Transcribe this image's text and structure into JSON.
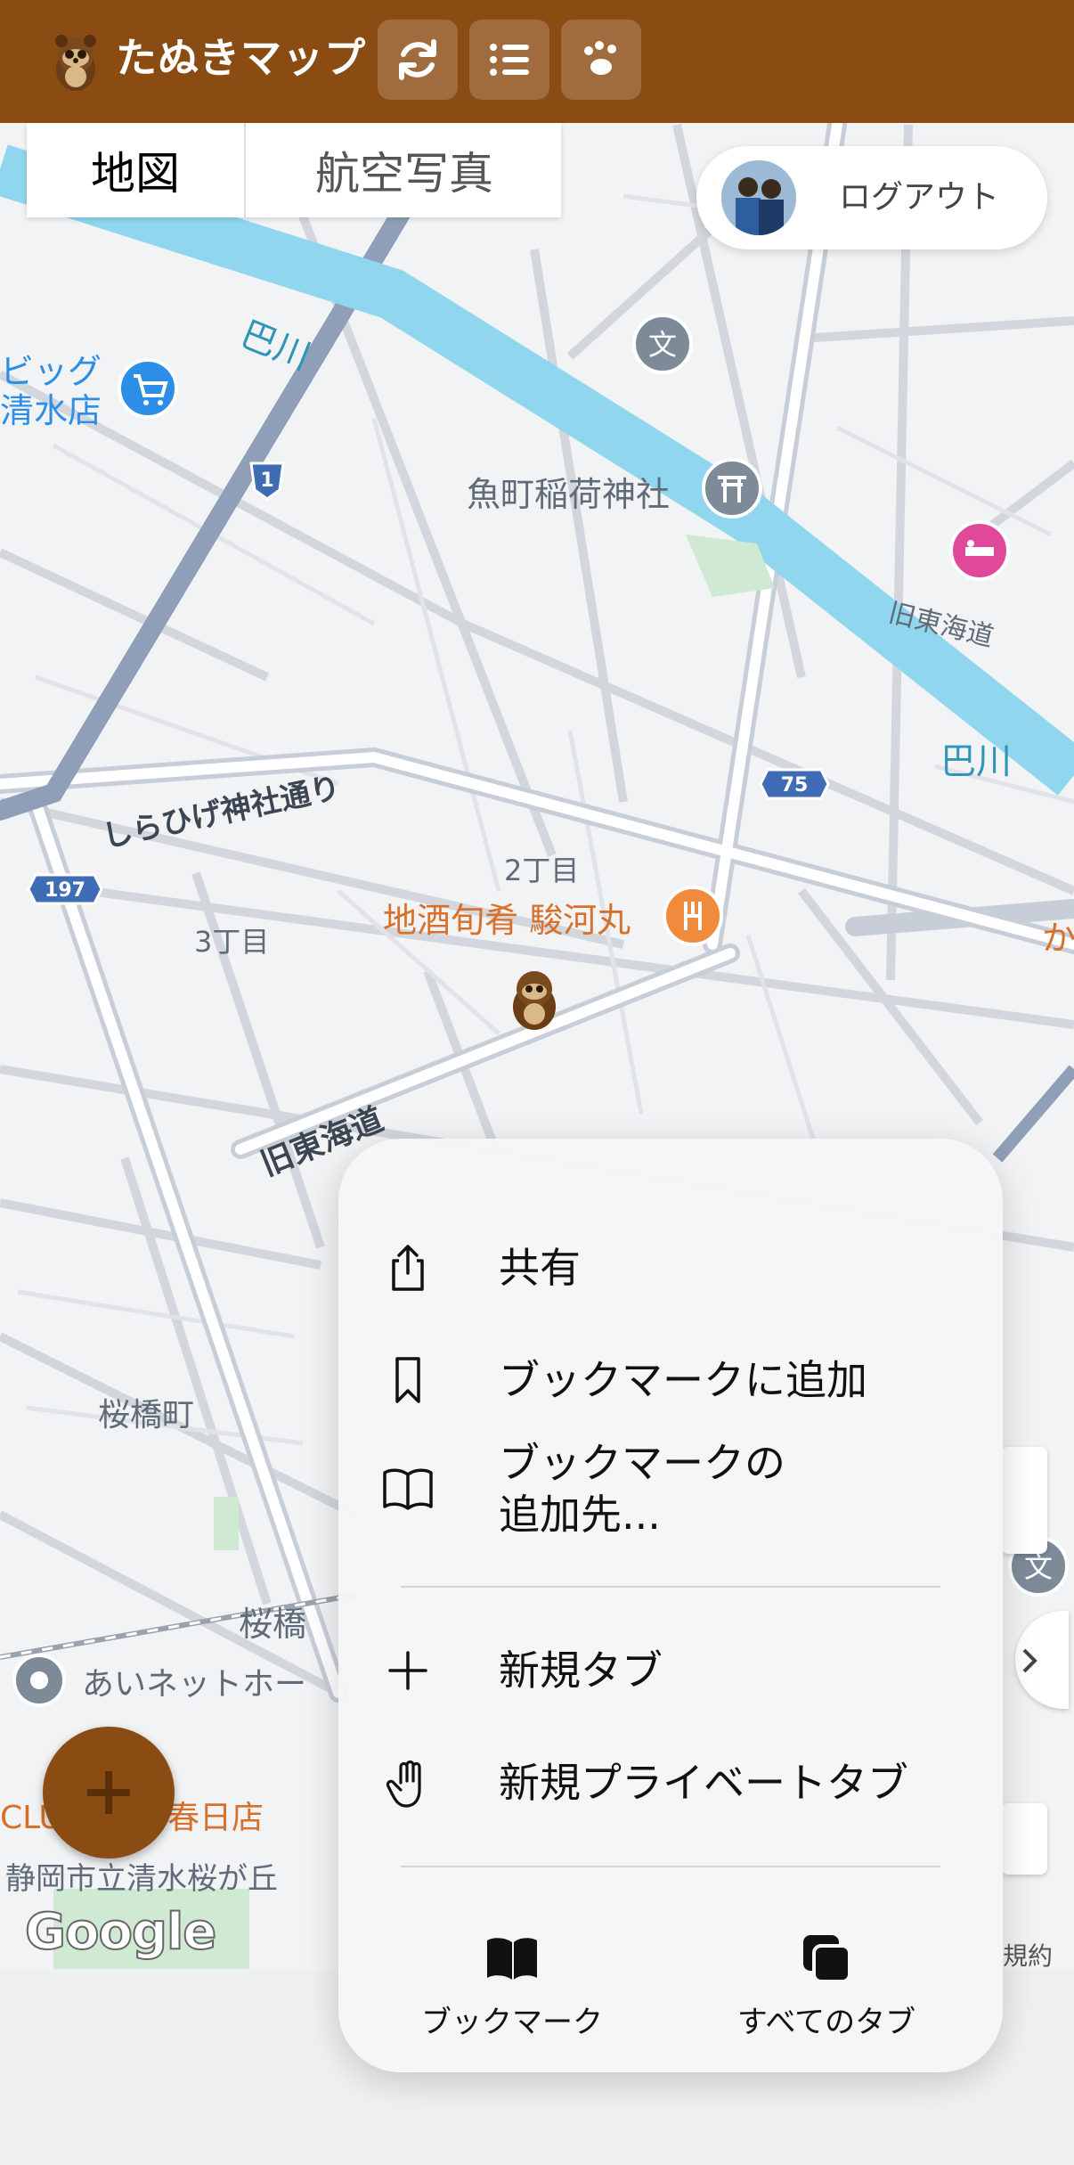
{
  "header": {
    "title": "たぬきマップ",
    "buttons": [
      "refresh-icon",
      "list-icon",
      "paw-icon"
    ]
  },
  "map_tabs": {
    "map": "地図",
    "satellite": "航空写真"
  },
  "user": {
    "logout_label": "ログアウト"
  },
  "map_labels": {
    "river1": "巴川",
    "river2": "巴川",
    "store_line1": "ビッグ",
    "store_line2": "清水店",
    "shrine": "魚町稲荷神社",
    "old_tokaido1": "旧東海道",
    "old_tokaido2": "旧東海道",
    "street": "しらひげ神社通り",
    "chome2": "2丁目",
    "chome3": "3丁目",
    "restaurant": "地酒旬肴 駿河丸",
    "edge_label": "か",
    "sakurabashi_cho": "桜橋町",
    "sakurabashi": "桜橋",
    "net": "あいネットホー",
    "kasuga": "春日店",
    "clu": "CLU",
    "school": "静岡市立清水桜が丘",
    "route1": "1",
    "route75": "75",
    "route197": "197",
    "google": "Google",
    "terms": "規約"
  },
  "context_menu": {
    "items": [
      {
        "icon": "share-icon",
        "label": "共有"
      },
      {
        "icon": "bookmark-icon",
        "label": "ブックマークに追加"
      },
      {
        "icon": "book-open-icon",
        "label_line1": "ブックマークの",
        "label_line2": "追加先..."
      },
      {
        "icon": "plus-icon",
        "label": "新規タブ"
      },
      {
        "icon": "hand-icon",
        "label": "新規プライベートタブ"
      }
    ],
    "bottom": [
      {
        "icon": "book-filled-icon",
        "label": "ブックマーク"
      },
      {
        "icon": "tabs-icon",
        "label": "すべてのタブ"
      }
    ]
  },
  "colors": {
    "header": "#8b4c14",
    "river": "#8fd6ee",
    "road": "#c9ced6",
    "highway": "#8e9fb7",
    "restaurant_pin": "#f08a3c",
    "hotel_pin": "#e0489a",
    "gray_pin": "#7d8b99"
  }
}
